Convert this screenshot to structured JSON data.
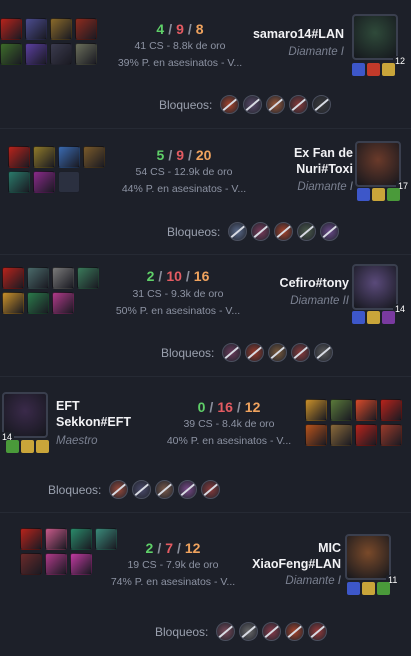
{
  "bans_label": "Bloqueos:",
  "matches": [
    {
      "kills": "4",
      "deaths": "9",
      "assists": "8",
      "cs": "41 CS - 8.8k de oro",
      "kp": "39% P. en asesinatos - V...",
      "name": "samaro14#LAN",
      "rank": "Diamante I",
      "level": "12",
      "items": [
        "#b8231b",
        "#4b4c8f",
        "#8a6a2a",
        "#8e2b1e",
        "#3d6b2a",
        "#5b3fa0",
        "#3b3b4e",
        "#6a6e5a"
      ],
      "avatar_color": "#2f4a3a",
      "spells": [
        "#3d57c9",
        "#c23a2a",
        "#c9a53a"
      ],
      "bans": [
        "#a8432a",
        "#5a4a6a",
        "#9b5a3a",
        "#8a3a3a",
        "#3a3a3a"
      ]
    },
    {
      "kills": "5",
      "deaths": "9",
      "assists": "20",
      "cs": "54 CS - 12.9k de oro",
      "kp": "44% P. en asesinatos - V...",
      "name": "Ex Fan de Nuri#Toxi",
      "rank": "Diamante I",
      "level": "17",
      "items": [
        "#b8231b",
        "#8f7a2a",
        "#3a6ab0",
        "#7a5a2a",
        "#2a7a6a",
        "#8a2a8a",
        "empty"
      ],
      "avatar_color": "#6a3a2a",
      "spells": [
        "#3d57c9",
        "#c9a53a",
        "#4a9a3a"
      ],
      "bans": [
        "#5a6a8a",
        "#7a3a5a",
        "#a8432a",
        "#4a5a4a",
        "#6a4a8a"
      ]
    },
    {
      "kills": "2",
      "deaths": "10",
      "assists": "16",
      "cs": "31 CS - 9.3k de oro",
      "kp": "50% P. en asesinatos - V...",
      "name": "Cefiro#tony",
      "rank": "Diamante II",
      "level": "14",
      "items": [
        "#b8231b",
        "#4a6a6a",
        "#7a7a7a",
        "#3a7a5a",
        "#c9902a",
        "#2a7a4a",
        "#b03a8a"
      ],
      "avatar_color": "#5a4a7a",
      "spells": [
        "#3d57c9",
        "#c9a53a",
        "#7a3aa0"
      ],
      "bans": [
        "#6a3a5a",
        "#9a3a2a",
        "#7a5a3a",
        "#8a3a3a",
        "#5a5a5a"
      ]
    },
    {
      "kills": "0",
      "deaths": "16",
      "assists": "12",
      "cs": "39 CS - 8.4k de oro",
      "kp": "40% P. en asesinatos - V...",
      "name": "EFT Sekkon#EFT",
      "rank": "Maestro",
      "level": "14",
      "items": [
        "#c9902a",
        "#5a7a3a",
        "#d84a2a",
        "#b8231b",
        "#b8531b",
        "#8a6a3a",
        "#b8231b",
        "#9a3a2a"
      ],
      "avatar_color": "#3a2a4a",
      "spells": [
        "#4a9a3a",
        "#c9a53a",
        "#c9a53a"
      ],
      "bans": [
        "#9b4a3a",
        "#4a4a6a",
        "#7a5a4a",
        "#7a4a8a",
        "#8a3a3a"
      ]
    },
    {
      "kills": "2",
      "deaths": "7",
      "assists": "12",
      "cs": "19 CS - 7.9k de oro",
      "kp": "74% P. en asesinatos - V...",
      "name": "MIC XiaoFeng#LAN",
      "rank": "Diamante I",
      "level": "11",
      "items": [
        "#b8231b",
        "#c85a8a",
        "#2a8a6a",
        "#3a8a7a",
        "#6a2a2a",
        "#b03a8a",
        "#c03aa0"
      ],
      "avatar_color": "#7a4a2a",
      "spells": [
        "#3d57c9",
        "#c9a53a",
        "#4a9a3a"
      ],
      "bans": [
        "#7a4a5a",
        "#6a6a6a",
        "#8a3a4a",
        "#a8432a",
        "#9a3a3a"
      ]
    }
  ]
}
